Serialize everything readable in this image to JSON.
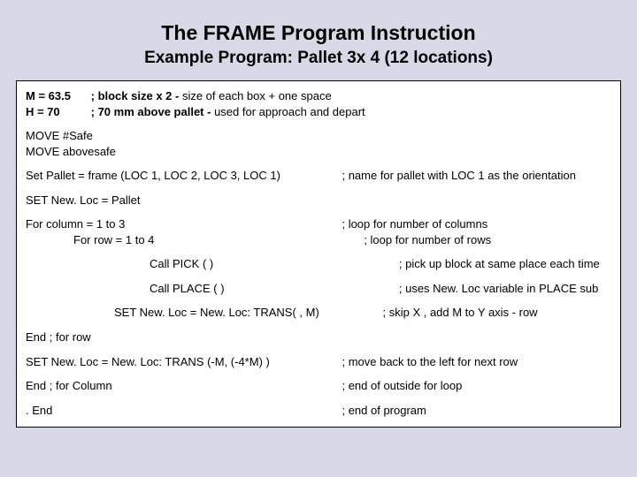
{
  "title": "The FRAME Program Instruction",
  "subtitle": "Example Program:  Pallet  3x 4  (12 locations)",
  "defs": {
    "m_var": "M = 63.5",
    "m_comment_b": "; block size x 2  -",
    "m_comment_rest": " size of each box + one space",
    "h_var": "H = 70",
    "h_comment_b": "; 70 mm above pallet -",
    "h_comment_rest": " used for approach and depart"
  },
  "moves": {
    "l1": "MOVE  #Safe",
    "l2": "MOVE  abovesafe"
  },
  "setpallet": {
    "code": "Set  Pallet = frame (LOC 1, LOC 2,  LOC 3, LOC 1)",
    "cmt": "; name for pallet  with LOC 1 as the orientation"
  },
  "setnewloc": "SET New. Loc = Pallet",
  "loop": {
    "col": "For column = 1 to 3",
    "row": "For row = 1 to 4",
    "col_cmt": "; loop for number of columns",
    "row_cmt": "; loop for number of rows",
    "pick": "Call PICK ( )",
    "pick_cmt": "; pick up block at same place each time",
    "place": "Call PLACE ( )",
    "place_cmt": "; uses New. Loc variable in PLACE sub",
    "trans": "SET New. Loc  = New. Loc: TRANS( , M)",
    "trans_cmt": "; skip X , add M to Y axis - row"
  },
  "end": {
    "endrow": "End ; for row",
    "trans2": "SET New. Loc = New. Loc: TRANS (-M, (-4*M) )",
    "trans2_cmt": "; move back to the left for next row",
    "endcol": " End ; for Column",
    "endcol_cmt": "; end of outside for loop",
    "endprog": " . End",
    "endprog_cmt": "; end of program"
  }
}
